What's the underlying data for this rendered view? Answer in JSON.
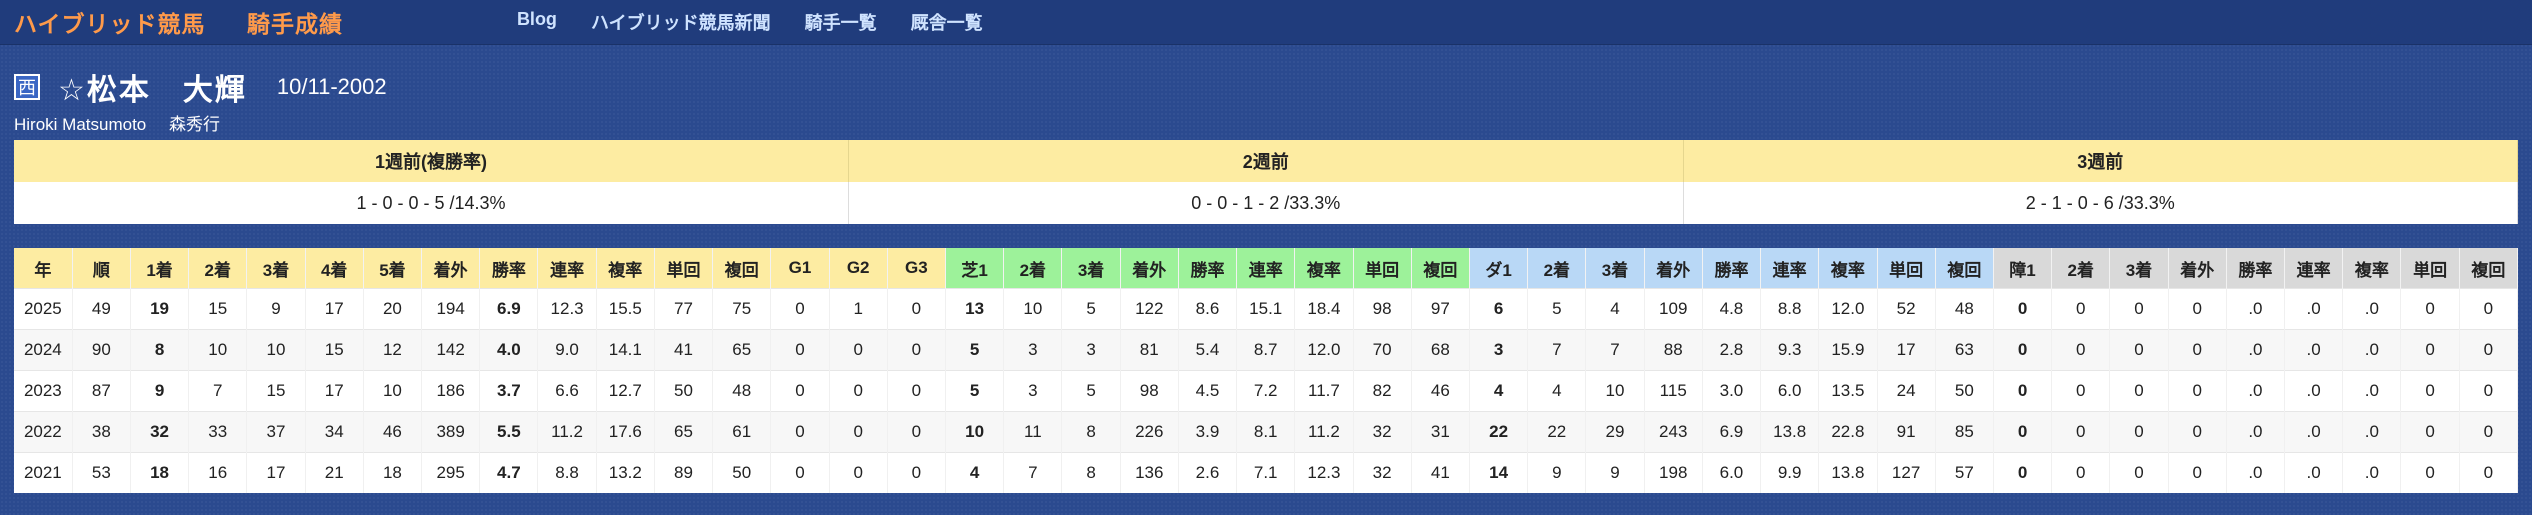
{
  "header": {
    "site_title": "ハイブリッド競馬",
    "page_title": "騎手成績",
    "nav": [
      "Blog",
      "ハイブリッド競馬新聞",
      "騎手一覧",
      "厩舎一覧"
    ]
  },
  "jockey": {
    "region": "西",
    "name": "☆松本　大輝",
    "birth": "10/11-2002",
    "romaji": "Hiroki Matsumoto",
    "stable": "森秀行"
  },
  "weekly": {
    "headers": [
      "1週前(複勝率)",
      "2週前",
      "3週前"
    ],
    "values": [
      "1 - 0 - 0 - 5 /14.3%",
      "0 - 0 - 1 - 2 /33.3%",
      "2 - 1 - 0 - 6 /33.3%"
    ]
  },
  "stats": {
    "headers": [
      "年",
      "順",
      "1着",
      "2着",
      "3着",
      "4着",
      "5着",
      "着外",
      "勝率",
      "連率",
      "複率",
      "単回",
      "複回",
      "G1",
      "G2",
      "G3",
      "芝1",
      "2着",
      "3着",
      "着外",
      "勝率",
      "連率",
      "複率",
      "単回",
      "複回",
      "ダ1",
      "2着",
      "3着",
      "着外",
      "勝率",
      "連率",
      "複率",
      "単回",
      "複回",
      "障1",
      "2着",
      "3着",
      "着外",
      "勝率",
      "連率",
      "複率",
      "単回",
      "複回"
    ],
    "rows": [
      [
        "2025",
        "49",
        "19",
        "15",
        "9",
        "17",
        "20",
        "194",
        "6.9",
        "12.3",
        "15.5",
        "77",
        "75",
        "0",
        "1",
        "0",
        "13",
        "10",
        "5",
        "122",
        "8.6",
        "15.1",
        "18.4",
        "98",
        "97",
        "6",
        "5",
        "4",
        "109",
        "4.8",
        "8.8",
        "12.0",
        "52",
        "48",
        "0",
        "0",
        "0",
        "0",
        ".0",
        ".0",
        ".0",
        "0",
        "0"
      ],
      [
        "2024",
        "90",
        "8",
        "10",
        "10",
        "15",
        "12",
        "142",
        "4.0",
        "9.0",
        "14.1",
        "41",
        "65",
        "0",
        "0",
        "0",
        "5",
        "3",
        "3",
        "81",
        "5.4",
        "8.7",
        "12.0",
        "70",
        "68",
        "3",
        "7",
        "7",
        "88",
        "2.8",
        "9.3",
        "15.9",
        "17",
        "63",
        "0",
        "0",
        "0",
        "0",
        ".0",
        ".0",
        ".0",
        "0",
        "0"
      ],
      [
        "2023",
        "87",
        "9",
        "7",
        "15",
        "17",
        "10",
        "186",
        "3.7",
        "6.6",
        "12.7",
        "50",
        "48",
        "0",
        "0",
        "0",
        "5",
        "3",
        "5",
        "98",
        "4.5",
        "7.2",
        "11.7",
        "82",
        "46",
        "4",
        "4",
        "10",
        "115",
        "3.0",
        "6.0",
        "13.5",
        "24",
        "50",
        "0",
        "0",
        "0",
        "0",
        ".0",
        ".0",
        ".0",
        "0",
        "0"
      ],
      [
        "2022",
        "38",
        "32",
        "33",
        "37",
        "34",
        "46",
        "389",
        "5.5",
        "11.2",
        "17.6",
        "65",
        "61",
        "0",
        "0",
        "0",
        "10",
        "11",
        "8",
        "226",
        "3.9",
        "8.1",
        "11.2",
        "32",
        "31",
        "22",
        "22",
        "29",
        "243",
        "6.9",
        "13.8",
        "22.8",
        "91",
        "85",
        "0",
        "0",
        "0",
        "0",
        ".0",
        ".0",
        ".0",
        "0",
        "0"
      ],
      [
        "2021",
        "53",
        "18",
        "16",
        "17",
        "21",
        "18",
        "295",
        "4.7",
        "8.8",
        "13.2",
        "89",
        "50",
        "0",
        "0",
        "0",
        "4",
        "7",
        "8",
        "136",
        "2.6",
        "7.1",
        "12.3",
        "32",
        "41",
        "14",
        "9",
        "9",
        "198",
        "6.0",
        "9.9",
        "13.8",
        "127",
        "57",
        "0",
        "0",
        "0",
        "0",
        ".0",
        ".0",
        ".0",
        "0",
        "0"
      ]
    ]
  }
}
